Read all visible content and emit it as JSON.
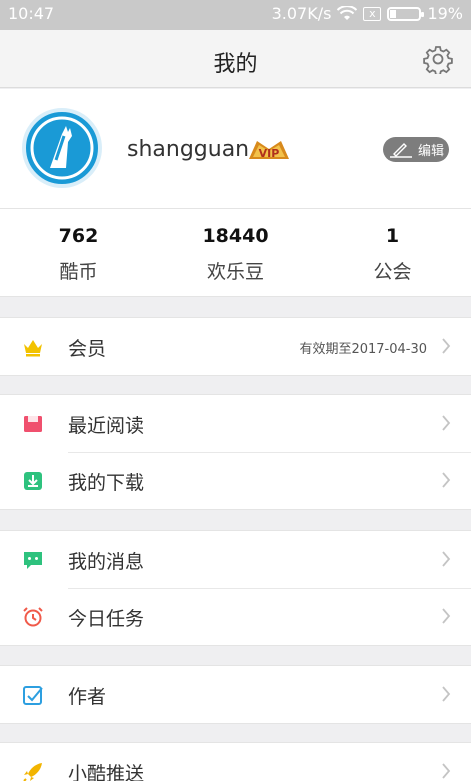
{
  "status_bar": {
    "time": "10:47",
    "speed": "3.07K/s",
    "sim": "x",
    "battery": "19%"
  },
  "header": {
    "title": "我的",
    "settings_icon": "gear-icon"
  },
  "profile": {
    "username": "shangguan",
    "vip_label": "VIP",
    "edit_label": "编辑",
    "avatar_icon": "app-logo-icon"
  },
  "stats": [
    {
      "value": "762",
      "label": "酷币"
    },
    {
      "value": "18440",
      "label": "欢乐豆"
    },
    {
      "value": "1",
      "label": "公会"
    }
  ],
  "menu": {
    "member": {
      "label": "会员",
      "value": "有效期至2017-04-30",
      "icon": "crown-icon",
      "color": "#f2c200"
    },
    "recent_read": {
      "label": "最近阅读",
      "icon": "book-icon",
      "color": "#f0506e"
    },
    "downloads": {
      "label": "我的下载",
      "icon": "download-icon",
      "color": "#2ec27e"
    },
    "messages": {
      "label": "我的消息",
      "icon": "message-icon",
      "color": "#2ec27e"
    },
    "tasks": {
      "label": "今日任务",
      "icon": "alarm-clock-icon",
      "color": "#f05a4a"
    },
    "author": {
      "label": "作者",
      "icon": "edit-box-icon",
      "color": "#2d9fe0"
    },
    "push": {
      "label": "小酷推送",
      "icon": "rocket-icon",
      "color": "#f2b400"
    }
  }
}
